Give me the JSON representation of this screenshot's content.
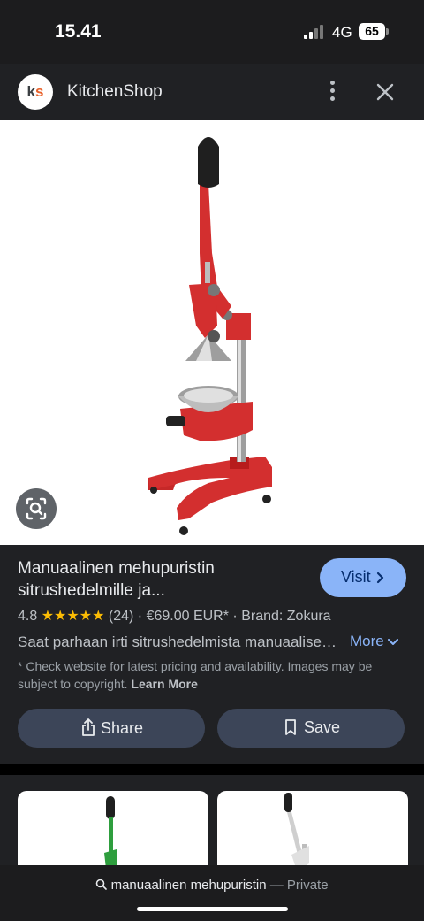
{
  "status": {
    "time": "15.41",
    "network": "4G",
    "battery": "65"
  },
  "header": {
    "site_name": "KitchenShop",
    "logo_k": "k",
    "logo_s": "s"
  },
  "product": {
    "title_line1": "Manuaalinen mehupuristin",
    "title_line2": "sitrushedelmille ja...",
    "visit_label": "Visit",
    "rating": "4.8",
    "stars": "★★★★★",
    "rating_fraction": 0.96,
    "review_count": "(24)",
    "separator": "·",
    "price": "€69.00 EUR*",
    "brand": "Brand: Zokura",
    "snippet": "Saat parhaan irti sitrushedelmista manuaalisella mehupuristimella",
    "more_label": "More",
    "disclaimer": "* Check website for latest pricing and availability. Images may be subject to copyright.",
    "learn_more": "Learn More",
    "share_label": "Share",
    "save_label": "Save"
  },
  "search_bar": {
    "query": "manuaalinen mehupuristin",
    "suffix": "— Private"
  },
  "colors": {
    "accent": "#8ab4f8",
    "star": "#fbbc04",
    "juicer_red": "#d32f2f",
    "related_green": "#2e9e3e"
  },
  "icons": {
    "more": "more-vert-icon",
    "close": "close-icon",
    "lens": "lens-search-icon",
    "share": "share-icon",
    "save": "bookmark-icon",
    "search": "search-icon"
  }
}
